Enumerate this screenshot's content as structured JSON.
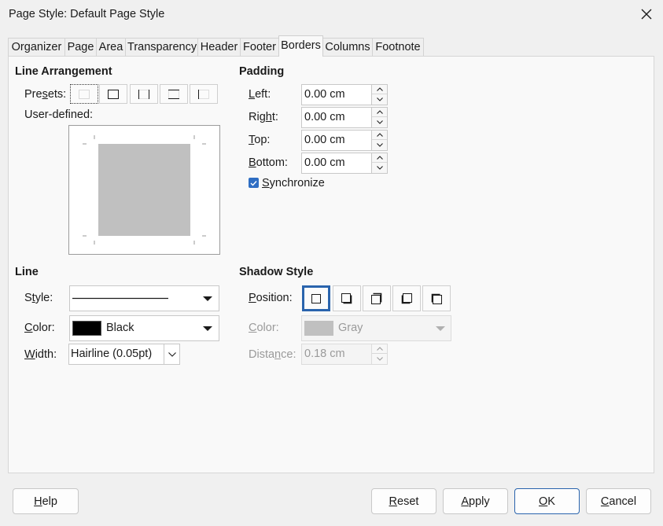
{
  "window": {
    "title": "Page Style: Default Page Style",
    "close_icon": "close-icon"
  },
  "tabs": [
    {
      "label": "Organizer",
      "active": false
    },
    {
      "label": "Page",
      "active": false
    },
    {
      "label": "Area",
      "active": false
    },
    {
      "label": "Transparency",
      "active": false
    },
    {
      "label": "Header",
      "active": false
    },
    {
      "label": "Footer",
      "active": false
    },
    {
      "label": "Borders",
      "active": true
    },
    {
      "label": "Columns",
      "active": false
    },
    {
      "label": "Footnote",
      "active": false
    }
  ],
  "line_arrangement": {
    "title": "Line Arrangement",
    "presets_label": "Presets:",
    "presets_label_pre": "Pre",
    "presets_label_u": "s",
    "presets_label_post": "ets:",
    "presets": [
      {
        "icon": "border-none-icon",
        "selected": true
      },
      {
        "icon": "border-all-icon",
        "selected": false
      },
      {
        "icon": "border-left-right-icon",
        "selected": false
      },
      {
        "icon": "border-top-bottom-icon",
        "selected": false
      },
      {
        "icon": "border-left-icon",
        "selected": false
      }
    ],
    "user_defined_label": "User-defined:"
  },
  "padding": {
    "title": "Padding",
    "fields": [
      {
        "label": "Left:",
        "u": "L",
        "rest": "eft:",
        "value": "0.00 cm"
      },
      {
        "label": "Right:",
        "pre": "Rig",
        "u": "h",
        "rest": "t:",
        "value": "0.00 cm"
      },
      {
        "label": "Top:",
        "u": "T",
        "rest": "op:",
        "value": "0.00 cm"
      },
      {
        "label": "Bottom:",
        "u": "B",
        "rest": "ottom:",
        "value": "0.00 cm"
      }
    ],
    "synchronize_label": "Synchronize",
    "synchronize_u": "S",
    "synchronize_rest": "ynchronize",
    "synchronize_checked": true
  },
  "line": {
    "title": "Line",
    "style_label": "Style:",
    "style_pre": "S",
    "style_u": "t",
    "style_rest": "yle:",
    "color_label": "Color:",
    "color_u": "C",
    "color_rest": "olor:",
    "color_value": "Black",
    "color_swatch": "#000000",
    "width_label": "Width:",
    "width_u": "W",
    "width_rest": "idth:",
    "width_value": "Hairline (0.05pt)"
  },
  "shadow": {
    "title": "Shadow Style",
    "position_label": "Position:",
    "position_u": "P",
    "position_rest": "osition:",
    "positions": [
      {
        "icon": "shadow-none-icon",
        "selected": true
      },
      {
        "icon": "shadow-bottom-right-icon",
        "selected": false
      },
      {
        "icon": "shadow-top-right-icon",
        "selected": false
      },
      {
        "icon": "shadow-bottom-left-icon",
        "selected": false
      },
      {
        "icon": "shadow-top-left-icon",
        "selected": false
      }
    ],
    "color_label": "Color:",
    "color_u": "C",
    "color_rest": "olor:",
    "color_value": "Gray",
    "color_swatch": "#c0c0c0",
    "distance_label": "Distance:",
    "distance_pre": "Dista",
    "distance_u": "n",
    "distance_rest": "ce:",
    "distance_value": "0.18 cm"
  },
  "buttons": {
    "help": {
      "label": "Help",
      "u": "H",
      "rest": "elp"
    },
    "reset": {
      "label": "Reset",
      "u": "R",
      "rest": "eset"
    },
    "apply": {
      "label": "Apply",
      "u": "A",
      "rest": "pply"
    },
    "ok": {
      "label": "OK",
      "u": "O",
      "rest": "K"
    },
    "cancel": {
      "label": "Cancel",
      "u": "C",
      "rest": "ancel"
    }
  },
  "colors": {
    "accent": "#2a64ad",
    "checkbox": "#2f6ec3",
    "preview_fill": "#c0c0c0"
  }
}
